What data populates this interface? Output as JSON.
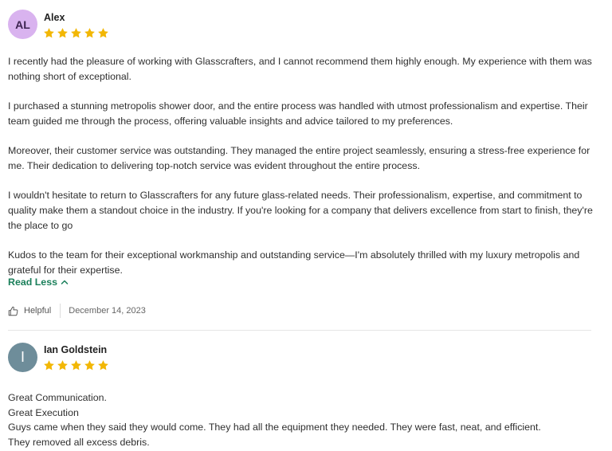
{
  "reviews": [
    {
      "initials": "AL",
      "name": "Alex",
      "rating": 5,
      "paragraphs": [
        "I recently had the pleasure of working with Glasscrafters, and I cannot recommend them highly enough. My experience with them was nothing short of exceptional.",
        "I purchased a stunning metropolis shower door, and the entire process was handled with utmost professionalism and expertise. Their team guided me through the process, offering valuable insights and advice tailored to my preferences.",
        "Moreover, their customer service was outstanding. They managed the entire project seamlessly, ensuring a stress-free experience for me. Their dedication to delivering top-notch service was evident throughout the entire process.",
        "I wouldn't hesitate to return to Glasscrafters  for any future glass-related needs. Their professionalism, expertise, and commitment to quality make them a standout choice in the industry. If you're looking for a company that delivers excellence from start to finish, they're the place to go",
        "Kudos to the team for their exceptional workmanship and outstanding service—I'm absolutely thrilled with my luxury metropolis and grateful for their expertise."
      ],
      "read_less_label": "Read Less",
      "helpful_label": "Helpful",
      "date": "December 14, 2023"
    },
    {
      "initials": "I",
      "name": "Ian Goldstein",
      "rating": 5,
      "lines": [
        "Great Communication.",
        "Great Execution",
        "Guys came when they said they would come.  They had all the equipment they needed.  They were fast, neat, and efficient.",
        "They removed all excess debris."
      ]
    }
  ],
  "colors": {
    "star": "#f2b705",
    "link": "#1a7f5a",
    "avatar_1": "#d9b3ef",
    "avatar_2": "#6e8d9a"
  },
  "icons": {
    "star": "star-icon",
    "thumbs_up": "thumbs-up-icon",
    "chevron_up": "chevron-up-icon"
  }
}
